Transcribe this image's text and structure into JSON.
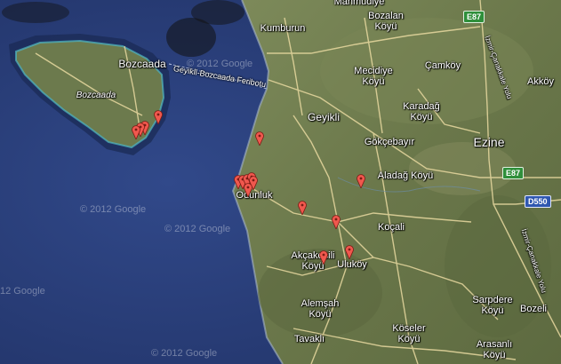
{
  "labels": {
    "mahmudiye": "Mahmudiye",
    "bozalan_1": "Bozalan",
    "bozalan_2": "Köyü",
    "kumburun": "Kumburun",
    "bozcaada": "Bozcaada",
    "bozcaada_italic": "Bozcaada",
    "mecidiye_1": "Mecidiye",
    "mecidiye_2": "Köyü",
    "camkoy": "Çamköy",
    "akkoy": "Akköy",
    "geyikli": "Geyikli",
    "karadag_1": "Karadağ",
    "karadag_2": "Köyü",
    "gokcebayir": "Gökçebayır",
    "ezine": "Ezine",
    "aladag": "Aladağ Köyü",
    "odunluk": "Odunluk",
    "kocali": "Koçali",
    "akcakecili_1": "Akçakecili",
    "akcakecili_2": "Köyü",
    "ulukoy": "Uluköy",
    "sarpdere_1": "Sarpdere",
    "sarpdere_2": "Köyü",
    "bozeli": "Bozeli",
    "alemsah_1": "Alemşah",
    "alemsah_2": "Köyü",
    "koseler_1": "Köseler",
    "koseler_2": "Köyü",
    "tavakli": "Tavaklı",
    "arasanli_1": "Arasanlı",
    "arasanli_2": "Köyü",
    "ferry": "Geyikli-Bozcaada Feribotu"
  },
  "shields": {
    "e87_top": "E87",
    "e87_mid": "E87",
    "d550": "D550"
  },
  "road_labels": {
    "izmir_yolu_1": "İzmir-Çanakkale Yolu",
    "izmir_yolu_2": "İzmir-Çanakkale Yolu"
  },
  "watermarks": [
    "© 2012 Google",
    "© 2012 Google",
    "© 2012 Google",
    "12 Google",
    "© 2012 Google"
  ],
  "colors": {
    "sea": "#2a3f7a",
    "land": "#6d7a4a",
    "marker": "#f0584e",
    "road": "#e8d9a0"
  },
  "markers_count": 16
}
